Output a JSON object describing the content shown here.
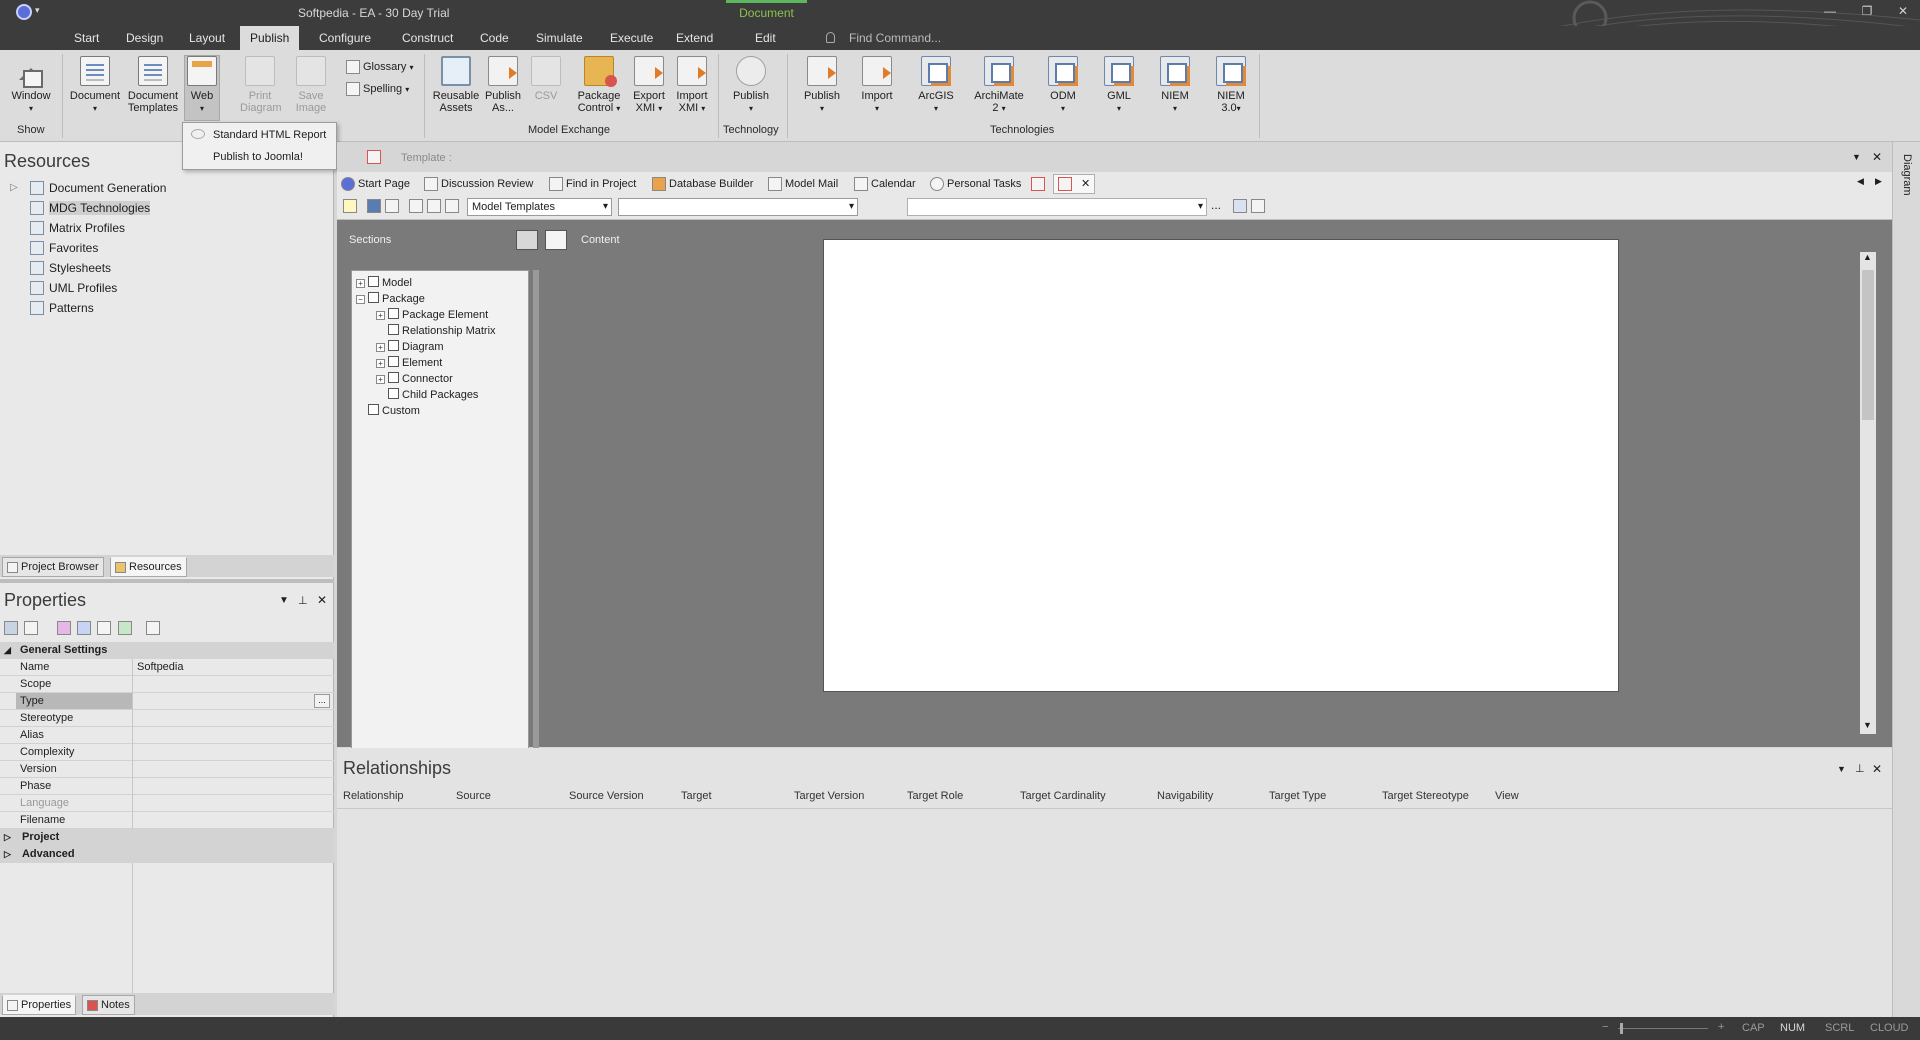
{
  "window": {
    "title": "Softpedia - EA - 30 Day Trial",
    "context_tab": "Document"
  },
  "menu": {
    "items": [
      "Start",
      "Design",
      "Layout",
      "Publish",
      "Configure",
      "Construct",
      "Code",
      "Simulate",
      "Execute",
      "Extend",
      "Edit"
    ],
    "find_placeholder": "Find Command..."
  },
  "ribbon": {
    "show_group": {
      "window": "Window",
      "label": "Show"
    },
    "report": {
      "document": "Document",
      "document_templates_1": "Document",
      "document_templates_2": "Templates",
      "web": "Web",
      "print_diagram_1": "Print",
      "print_diagram_2": "Diagram",
      "save_image_1": "Save",
      "save_image_2": "Image",
      "glossary": "Glossary",
      "spelling": "Spelling"
    },
    "model_exchange": {
      "reusable_1": "Reusable",
      "reusable_2": "Assets",
      "publish_as_1": "Publish",
      "publish_as_2": "As...",
      "csv": "CSV",
      "package_control_1": "Package",
      "package_control_2": "Control",
      "export_xmi_1": "Export",
      "export_xmi_2": "XMI",
      "import_xmi_1": "Import",
      "import_xmi_2": "XMI",
      "label": "Model Exchange"
    },
    "technology": {
      "publish": "Publish",
      "label": "Technology"
    },
    "technologies": {
      "publish": "Publish",
      "import": "Import",
      "arcgis": "ArcGIS",
      "archimate_1": "ArchiMate",
      "archimate_2": "2",
      "odm": "ODM",
      "gml": "GML",
      "niem": "NIEM",
      "niem3_1": "NIEM",
      "niem3_2": "3.0",
      "label": "Technologies"
    }
  },
  "web_dropdown": {
    "items": [
      "Standard HTML Report",
      "Publish to Joomla!"
    ]
  },
  "resources": {
    "title": "Resources",
    "items": [
      "Document Generation",
      "MDG Technologies",
      "Matrix Profiles",
      "Favorites",
      "Stylesheets",
      "UML Profiles",
      "Patterns"
    ],
    "tabs": [
      "Project Browser",
      "Resources"
    ]
  },
  "properties": {
    "title": "Properties",
    "groups": {
      "general": "General Settings",
      "project": "Project",
      "advanced": "Advanced"
    },
    "rows": [
      {
        "key": "Name",
        "value": "Softpedia"
      },
      {
        "key": "Scope",
        "value": ""
      },
      {
        "key": "Type",
        "value": ""
      },
      {
        "key": "Stereotype",
        "value": ""
      },
      {
        "key": "Alias",
        "value": ""
      },
      {
        "key": "Complexity",
        "value": ""
      },
      {
        "key": "Version",
        "value": ""
      },
      {
        "key": "Phase",
        "value": ""
      },
      {
        "key": "Language",
        "value": ""
      },
      {
        "key": "Filename",
        "value": ""
      }
    ],
    "tabs": [
      "Properties",
      "Notes"
    ]
  },
  "editor": {
    "template_label": "Template :",
    "doc_tabs": [
      "Start Page",
      "Discussion Review",
      "Find in Project",
      "Database Builder",
      "Model Mail",
      "Calendar",
      "Personal Tasks"
    ],
    "combo_templates": "Model Templates",
    "ellipsis": "...",
    "sections_label": "Sections",
    "content_label": "Content",
    "sections": [
      {
        "label": "Model",
        "level": 0,
        "exp": "+"
      },
      {
        "label": "Package",
        "level": 0,
        "exp": "−"
      },
      {
        "label": "Package Element",
        "level": 1,
        "exp": "+"
      },
      {
        "label": "Relationship Matrix",
        "level": 1,
        "exp": ""
      },
      {
        "label": "Diagram",
        "level": 1,
        "exp": "+"
      },
      {
        "label": "Element",
        "level": 1,
        "exp": "+"
      },
      {
        "label": "Connector",
        "level": 1,
        "exp": "+"
      },
      {
        "label": "Child Packages",
        "level": 1,
        "exp": ""
      },
      {
        "label": "Custom",
        "level": 0,
        "exp": ""
      }
    ]
  },
  "relationships": {
    "title": "Relationships",
    "columns": [
      "Relationship",
      "Source",
      "Source Version",
      "Target",
      "Target Version",
      "Target Role",
      "Target Cardinality",
      "Navigability",
      "Target Type",
      "Target Stereotype",
      "View"
    ]
  },
  "right_strip": {
    "label": "Diagram"
  },
  "status": {
    "items": [
      "CAP",
      "NUM",
      "SCRL",
      "CLOUD"
    ],
    "zoom_minus": "−",
    "zoom_plus": "+"
  }
}
